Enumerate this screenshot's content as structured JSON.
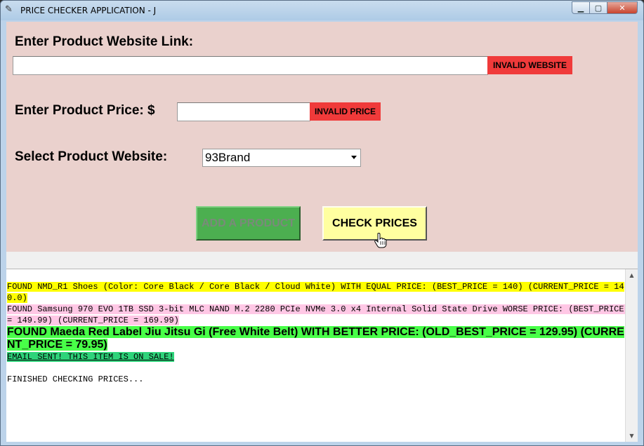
{
  "window": {
    "title": "PRICE CHECKER APPLICATION - J",
    "icon": "feather-icon",
    "min_glyph": "▁",
    "max_glyph": "▢",
    "close_glyph": "✕"
  },
  "form": {
    "link_label": "Enter Product Website Link:",
    "link_value": "",
    "link_warning": "INVALID WEBSITE",
    "price_label": "Enter Product Price: $",
    "price_value": "",
    "price_warning": "INVALID PRICE",
    "site_label": "Select Product Website:",
    "site_selected": "93Brand"
  },
  "buttons": {
    "add_label": "ADD A PRODUCT",
    "check_label": "CHECK PRICES"
  },
  "log": {
    "lines": [
      "FOUND NMD_R1 Shoes (Color: Core Black / Core Black / Cloud White) WITH EQUAL PRICE: (BEST_PRICE = 140) (CURRENT_PRICE = 140.0)",
      "FOUND Samsung 970 EVO 1TB SSD 3-bit MLC NAND M.2 2280 PCIe NVMe 3.0 x4 Internal Solid State Drive WORSE PRICE: (BEST_PRICE = 149.99) (CURRENT_PRICE = 169.99)",
      "FOUND Maeda Red Label Jiu Jitsu Gi (Free White Belt) WITH BETTER PRICE: (OLD_BEST_PRICE = 129.95) (CURRENT_PRICE = 79.95)",
      "EMAIL SENT! THIS ITEM IS ON SALE!",
      "",
      "FINISHED CHECKING PRICES..."
    ]
  },
  "colors": {
    "form_bg": "#ead1cd",
    "warning": "#f03a3a",
    "add_button": "#4caf50",
    "check_button": "#ffffa0",
    "equal_highlight": "#ffff00",
    "worse_highlight": "#ffc7e5",
    "better_highlight": "#48ff48",
    "email_highlight": "#2ed37a"
  }
}
